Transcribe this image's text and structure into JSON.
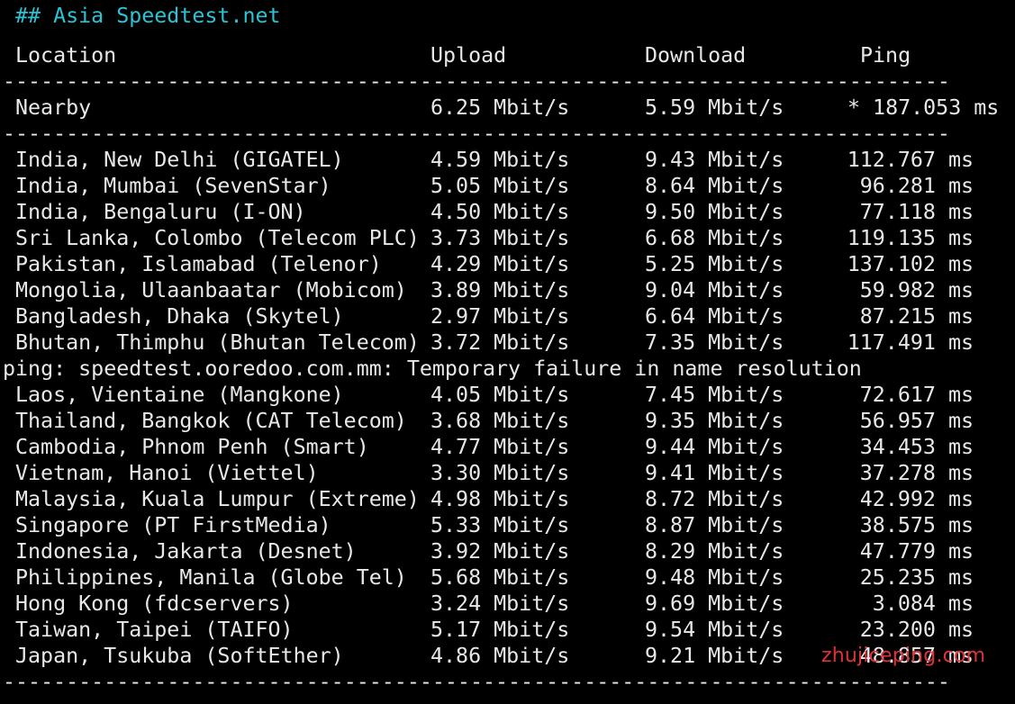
{
  "heading": "## Asia Speedtest.net",
  "columns": {
    "location": "Location",
    "upload": "Upload",
    "download": "Download",
    "ping": "Ping"
  },
  "separator": "--------------------------------------------------------------------------------------------------------------------------------",
  "nearby": {
    "location": "Nearby",
    "upload": "6.25 Mbit/s",
    "download": "5.59 Mbit/s",
    "ping": "* 187.053 ms"
  },
  "rows_a": [
    {
      "location": "India, New Delhi (GIGATEL)",
      "upload": "4.59 Mbit/s",
      "download": "9.43 Mbit/s",
      "ping": "112.767 ms"
    },
    {
      "location": "India, Mumbai (SevenStar)",
      "upload": "5.05 Mbit/s",
      "download": "8.64 Mbit/s",
      "ping": "96.281 ms"
    },
    {
      "location": "India, Bengaluru (I-ON)",
      "upload": "4.50 Mbit/s",
      "download": "9.50 Mbit/s",
      "ping": "77.118 ms"
    },
    {
      "location": "Sri Lanka, Colombo (Telecom PLC)",
      "upload": "3.73 Mbit/s",
      "download": "6.68 Mbit/s",
      "ping": "119.135 ms"
    },
    {
      "location": "Pakistan, Islamabad (Telenor)",
      "upload": "4.29 Mbit/s",
      "download": "5.25 Mbit/s",
      "ping": "137.102 ms"
    },
    {
      "location": "Mongolia, Ulaanbaatar (Mobicom)",
      "upload": "3.89 Mbit/s",
      "download": "9.04 Mbit/s",
      "ping": "59.982 ms"
    },
    {
      "location": "Bangladesh, Dhaka (Skytel)",
      "upload": "2.97 Mbit/s",
      "download": "6.64 Mbit/s",
      "ping": "87.215 ms"
    },
    {
      "location": "Bhutan, Thimphu (Bhutan Telecom)",
      "upload": "3.72 Mbit/s",
      "download": "7.35 Mbit/s",
      "ping": "117.491 ms"
    }
  ],
  "error_message": "ping: speedtest.ooredoo.com.mm: Temporary failure in name resolution",
  "rows_b": [
    {
      "location": "Laos, Vientaine (Mangkone)",
      "upload": "4.05 Mbit/s",
      "download": "7.45 Mbit/s",
      "ping": "72.617 ms"
    },
    {
      "location": "Thailand, Bangkok (CAT Telecom)",
      "upload": "3.68 Mbit/s",
      "download": "9.35 Mbit/s",
      "ping": "56.957 ms"
    },
    {
      "location": "Cambodia, Phnom Penh (Smart)",
      "upload": "4.77 Mbit/s",
      "download": "9.44 Mbit/s",
      "ping": "34.453 ms"
    },
    {
      "location": "Vietnam, Hanoi (Viettel)",
      "upload": "3.30 Mbit/s",
      "download": "9.41 Mbit/s",
      "ping": "37.278 ms"
    },
    {
      "location": "Malaysia, Kuala Lumpur (Extreme)",
      "upload": "4.98 Mbit/s",
      "download": "8.72 Mbit/s",
      "ping": "42.992 ms"
    },
    {
      "location": "Singapore (PT FirstMedia)",
      "upload": "5.33 Mbit/s",
      "download": "8.87 Mbit/s",
      "ping": "38.575 ms"
    },
    {
      "location": "Indonesia, Jakarta (Desnet)",
      "upload": "3.92 Mbit/s",
      "download": "8.29 Mbit/s",
      "ping": "47.779 ms"
    },
    {
      "location": "Philippines, Manila (Globe Tel)",
      "upload": "5.68 Mbit/s",
      "download": "9.48 Mbit/s",
      "ping": "25.235 ms"
    },
    {
      "location": "Hong Kong (fdcservers)",
      "upload": "3.24 Mbit/s",
      "download": "9.69 Mbit/s",
      "ping": "3.084 ms"
    },
    {
      "location": "Taiwan, Taipei (TAIFO)",
      "upload": "5.17 Mbit/s",
      "download": "9.54 Mbit/s",
      "ping": "23.200 ms"
    },
    {
      "location": "Japan, Tsukuba (SoftEther)",
      "upload": "4.86 Mbit/s",
      "download": "9.21 Mbit/s",
      "ping": "48.857 ms"
    }
  ],
  "watermark": "zhujiceping.com",
  "colors": {
    "background": "#000000",
    "text": "#e8e8e8",
    "heading": "#2bc4d6",
    "watermark": "#e0323a"
  }
}
